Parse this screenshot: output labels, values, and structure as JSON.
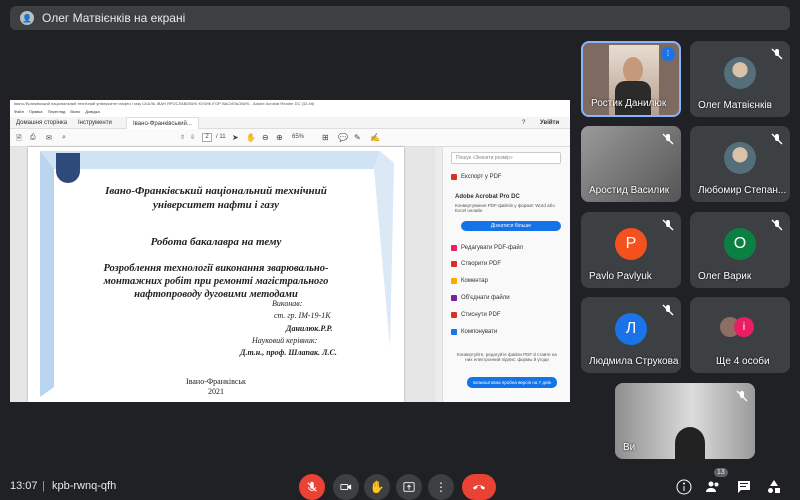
{
  "presentation_bar": {
    "text": "Олег Матвієнків на екрані"
  },
  "pdf": {
    "window_title": "Івано-Франківський національний технічний університет нафти і газу  СКАЛЬ ІВАН ЯРОСЛАВОВИЧ КУЗИК ІГОР ВАСИЛЬОВИЧ - Adobe Acrobat Reader DC (32-bit)",
    "menu": "Файл  Правка  Перегляд  Вікно  Довідка",
    "tab_home": "Домашня сторінка",
    "tab_tools": "Інструменти",
    "tab_doc": "Івано-Франківський...",
    "signin": "Увійти",
    "page_current": "2",
    "page_total": "/ 11",
    "zoom": "65%",
    "page_lines": {
      "uni1": "Івано-Франківський національний технічний",
      "uni2": "університет нафти і газу",
      "work": "Робота бакалавра на тему",
      "topic1": "Розроблення технології виконання зварювально-",
      "topic2": "монтажних робіт при ремонті магістрального",
      "topic3": "нафтопроводу дуговими методами",
      "done": "Виконав:",
      "group": "ст. гр. ІМ-19-1К",
      "student": "Данилюк.Р.Р.",
      "sup_label": "Науковий керівник:",
      "supervisor": "Д.т.н., проф. Шлапак. Л.С.",
      "city": "Івано-Франківськ",
      "year": "2021"
    },
    "sidebar": {
      "search_placeholder": "Пошук «Змінити розмір»",
      "export": "Експорт у PDF",
      "promo_title": "Adobe Acrobat Pro DC",
      "promo_text": "Конвертування PDF-файлів у формат Word або Excel онлайн",
      "promo_button": "Дізнатися більше",
      "items": [
        "Редагувати PDF-файл",
        "Створити PDF",
        "Коментар",
        "Об'єднати файли",
        "Стиснути PDF",
        "Компонувати"
      ],
      "footer": "Конвертуйте, редагуйте файли PDF й ставте на них електронний підпис: формы й угоди",
      "footer_button": "Безкоштовна пробна версія на 7 днів"
    }
  },
  "participants": [
    {
      "name": "Ростик Данилюк",
      "type": "video",
      "active": true
    },
    {
      "name": "Олег Матвієнків",
      "type": "avatar-photo"
    },
    {
      "name": "Аростид Василик",
      "type": "video"
    },
    {
      "name": "Любомир Степан...",
      "type": "avatar-photo"
    },
    {
      "name": "Pavlo Pavlyuk",
      "type": "letter",
      "letter": "P",
      "color": "#f4511e"
    },
    {
      "name": "Олег Варик",
      "type": "letter",
      "letter": "О",
      "color": "#0b8043"
    },
    {
      "name": "Людмила Струкова",
      "type": "letter",
      "letter": "Л",
      "color": "#1a73e8"
    },
    {
      "name": "Ще 4 особи",
      "type": "more",
      "letter": "і",
      "color": "#e91e63"
    },
    {
      "name": "Ви",
      "type": "self"
    }
  ],
  "bottom": {
    "time": "13:07",
    "separator": "|",
    "meeting_code": "kpb-rwnq-qfh",
    "people_count": "13"
  },
  "colors": {
    "end_red": "#ea4335",
    "active_border": "#8ab4f8",
    "mic_red": "#ea4335"
  }
}
